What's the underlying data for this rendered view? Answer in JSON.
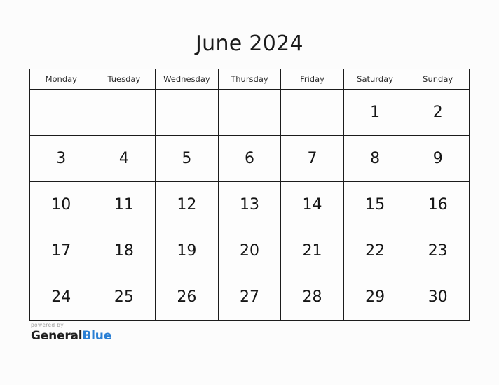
{
  "calendar": {
    "title": "June 2024",
    "weekday_headers": [
      "Monday",
      "Tuesday",
      "Wednesday",
      "Thursday",
      "Friday",
      "Saturday",
      "Sunday"
    ],
    "weeks": [
      [
        "",
        "",
        "",
        "",
        "",
        "1",
        "2"
      ],
      [
        "3",
        "4",
        "5",
        "6",
        "7",
        "8",
        "9"
      ],
      [
        "10",
        "11",
        "12",
        "13",
        "14",
        "15",
        "16"
      ],
      [
        "17",
        "18",
        "19",
        "20",
        "21",
        "22",
        "23"
      ],
      [
        "24",
        "25",
        "26",
        "27",
        "28",
        "29",
        "30"
      ]
    ]
  },
  "footer": {
    "powered_by": "powered by",
    "brand_first": "General",
    "brand_second": "Blue",
    "brand_accent_color": "#2a7fd4"
  }
}
